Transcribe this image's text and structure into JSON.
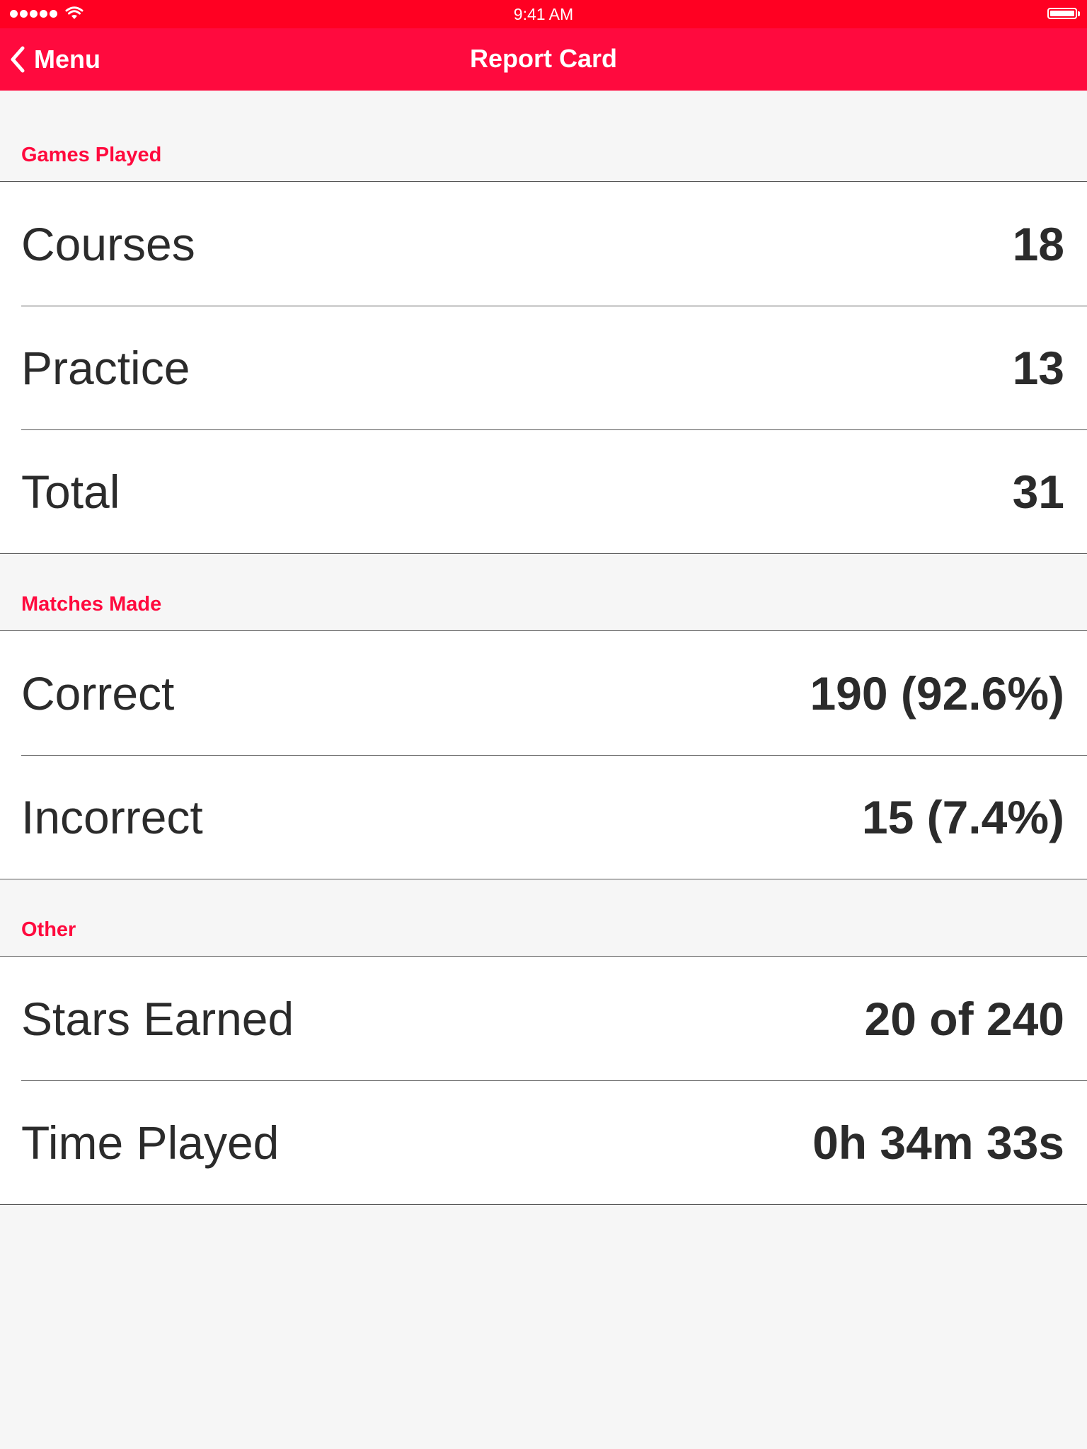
{
  "status_bar": {
    "time": "9:41 AM"
  },
  "nav": {
    "back_label": "Menu",
    "title": "Report Card"
  },
  "colors": {
    "accent": "#ff0a3e",
    "status_bar": "#ff0022",
    "background": "#f6f6f6"
  },
  "sections": [
    {
      "header": "Games Played",
      "rows": [
        {
          "label": "Courses",
          "value": "18"
        },
        {
          "label": "Practice",
          "value": "13"
        },
        {
          "label": "Total",
          "value": "31"
        }
      ]
    },
    {
      "header": "Matches Made",
      "rows": [
        {
          "label": "Correct",
          "value": "190 (92.6%)"
        },
        {
          "label": "Incorrect",
          "value": "15 (7.4%)"
        }
      ]
    },
    {
      "header": "Other",
      "rows": [
        {
          "label": "Stars Earned",
          "value": "20 of 240"
        },
        {
          "label": "Time Played",
          "value": "0h 34m 33s"
        }
      ]
    }
  ]
}
